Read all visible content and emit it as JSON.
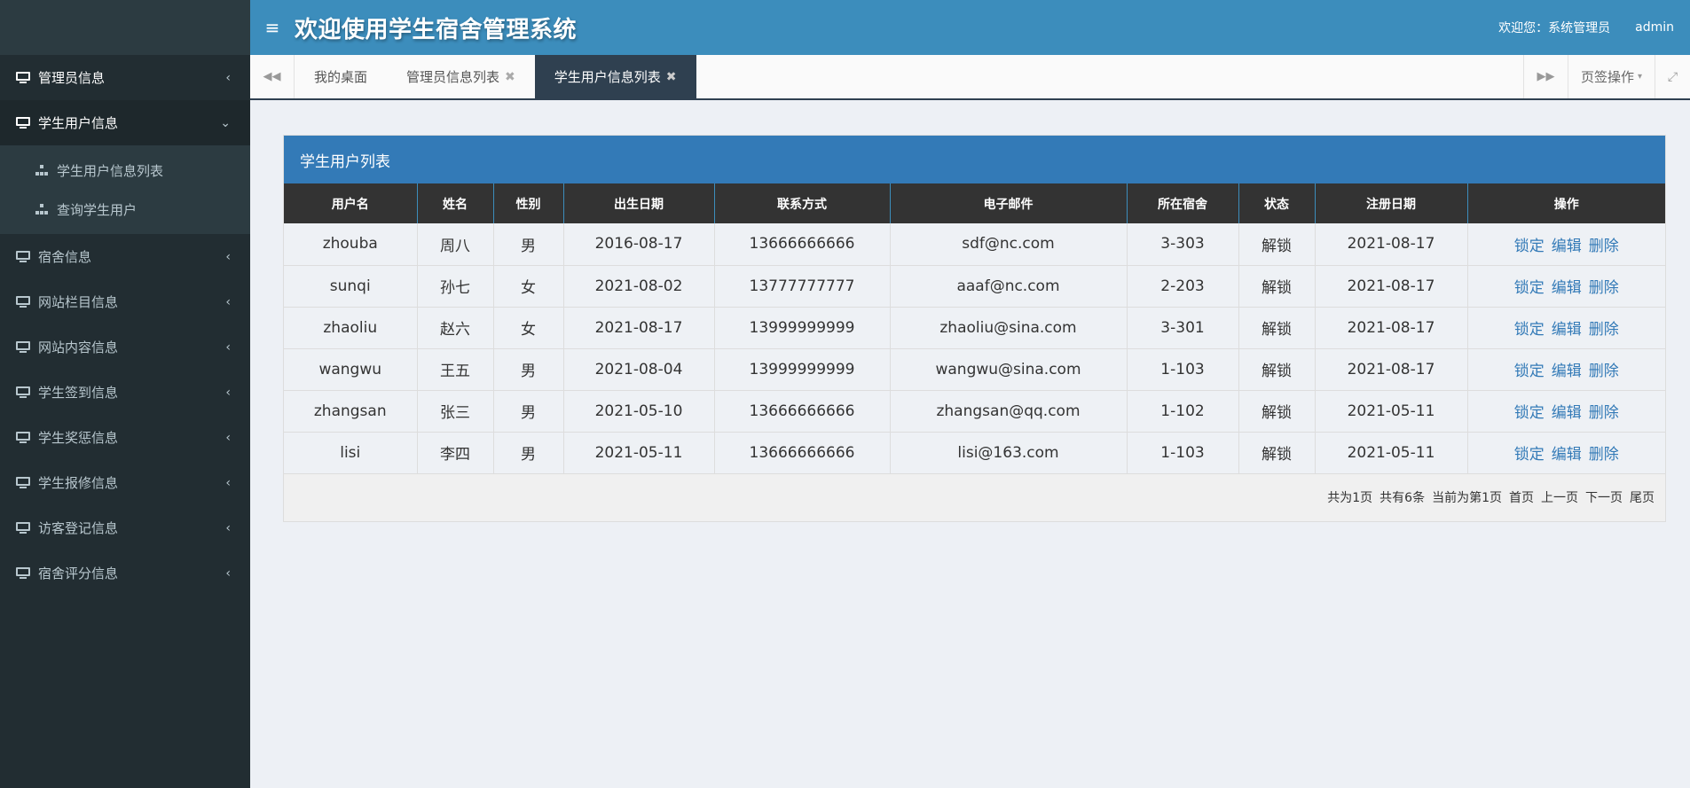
{
  "header": {
    "title": "欢迎使用学生宿舍管理系统",
    "menu_icon": "≡",
    "welcome": "欢迎您：系统管理员",
    "user": "admin"
  },
  "sidebar": {
    "items": [
      {
        "label": "管理员信息",
        "chev": "‹"
      },
      {
        "label": "学生用户信息",
        "chev": "⌄"
      },
      {
        "label": "宿舍信息",
        "chev": "‹"
      },
      {
        "label": "网站栏目信息",
        "chev": "‹"
      },
      {
        "label": "网站内容信息",
        "chev": "‹"
      },
      {
        "label": "学生签到信息",
        "chev": "‹"
      },
      {
        "label": "学生奖惩信息",
        "chev": "‹"
      },
      {
        "label": "学生报修信息",
        "chev": "‹"
      },
      {
        "label": "访客登记信息",
        "chev": "‹"
      },
      {
        "label": "宿舍评分信息",
        "chev": "‹"
      }
    ],
    "submenu": [
      {
        "label": "学生用户信息列表"
      },
      {
        "label": "查询学生用户"
      }
    ]
  },
  "tabbar": {
    "prev_icon": "◀◀",
    "next_icon": "▶▶",
    "tabs": [
      {
        "label": "我的桌面",
        "close": ""
      },
      {
        "label": "管理员信息列表",
        "close": "✖"
      },
      {
        "label": "学生用户信息列表",
        "close": "✖"
      }
    ],
    "page_ops": "页签操作",
    "caret": "▾",
    "fullscreen_icon": "⤢"
  },
  "panel": {
    "title": "学生用户列表",
    "columns": [
      "用户名",
      "姓名",
      "性别",
      "出生日期",
      "联系方式",
      "电子邮件",
      "所在宿舍",
      "状态",
      "注册日期",
      "操作"
    ],
    "rows": [
      {
        "username": "zhouba",
        "name": "周八",
        "gender": "男",
        "birth": "2016-08-17",
        "phone": "13666666666",
        "email": "sdf@nc.com",
        "dorm": "3-303",
        "status": "解锁",
        "reg": "2021-08-17"
      },
      {
        "username": "sunqi",
        "name": "孙七",
        "gender": "女",
        "birth": "2021-08-02",
        "phone": "13777777777",
        "email": "aaaf@nc.com",
        "dorm": "2-203",
        "status": "解锁",
        "reg": "2021-08-17"
      },
      {
        "username": "zhaoliu",
        "name": "赵六",
        "gender": "女",
        "birth": "2021-08-17",
        "phone": "13999999999",
        "email": "zhaoliu@sina.com",
        "dorm": "3-301",
        "status": "解锁",
        "reg": "2021-08-17"
      },
      {
        "username": "wangwu",
        "name": "王五",
        "gender": "男",
        "birth": "2021-08-04",
        "phone": "13999999999",
        "email": "wangwu@sina.com",
        "dorm": "1-103",
        "status": "解锁",
        "reg": "2021-08-17"
      },
      {
        "username": "zhangsan",
        "name": "张三",
        "gender": "男",
        "birth": "2021-05-10",
        "phone": "13666666666",
        "email": "zhangsan@qq.com",
        "dorm": "1-102",
        "status": "解锁",
        "reg": "2021-05-11"
      },
      {
        "username": "lisi",
        "name": "李四",
        "gender": "男",
        "birth": "2021-05-11",
        "phone": "13666666666",
        "email": "lisi@163.com",
        "dorm": "1-103",
        "status": "解锁",
        "reg": "2021-05-11"
      }
    ],
    "actions": {
      "lock": "锁定",
      "edit": "编辑",
      "delete": "删除"
    },
    "pager": {
      "total_pages": "共为1页",
      "total_records": "共有6条",
      "current": "当前为第1页",
      "first": "首页",
      "prev": "上一页",
      "next": "下一页",
      "last": "尾页"
    }
  },
  "colors": {
    "header": "#3c8dbc",
    "sidebar": "#222d32",
    "panel_head": "#337ab7",
    "link": "#337ab7"
  }
}
